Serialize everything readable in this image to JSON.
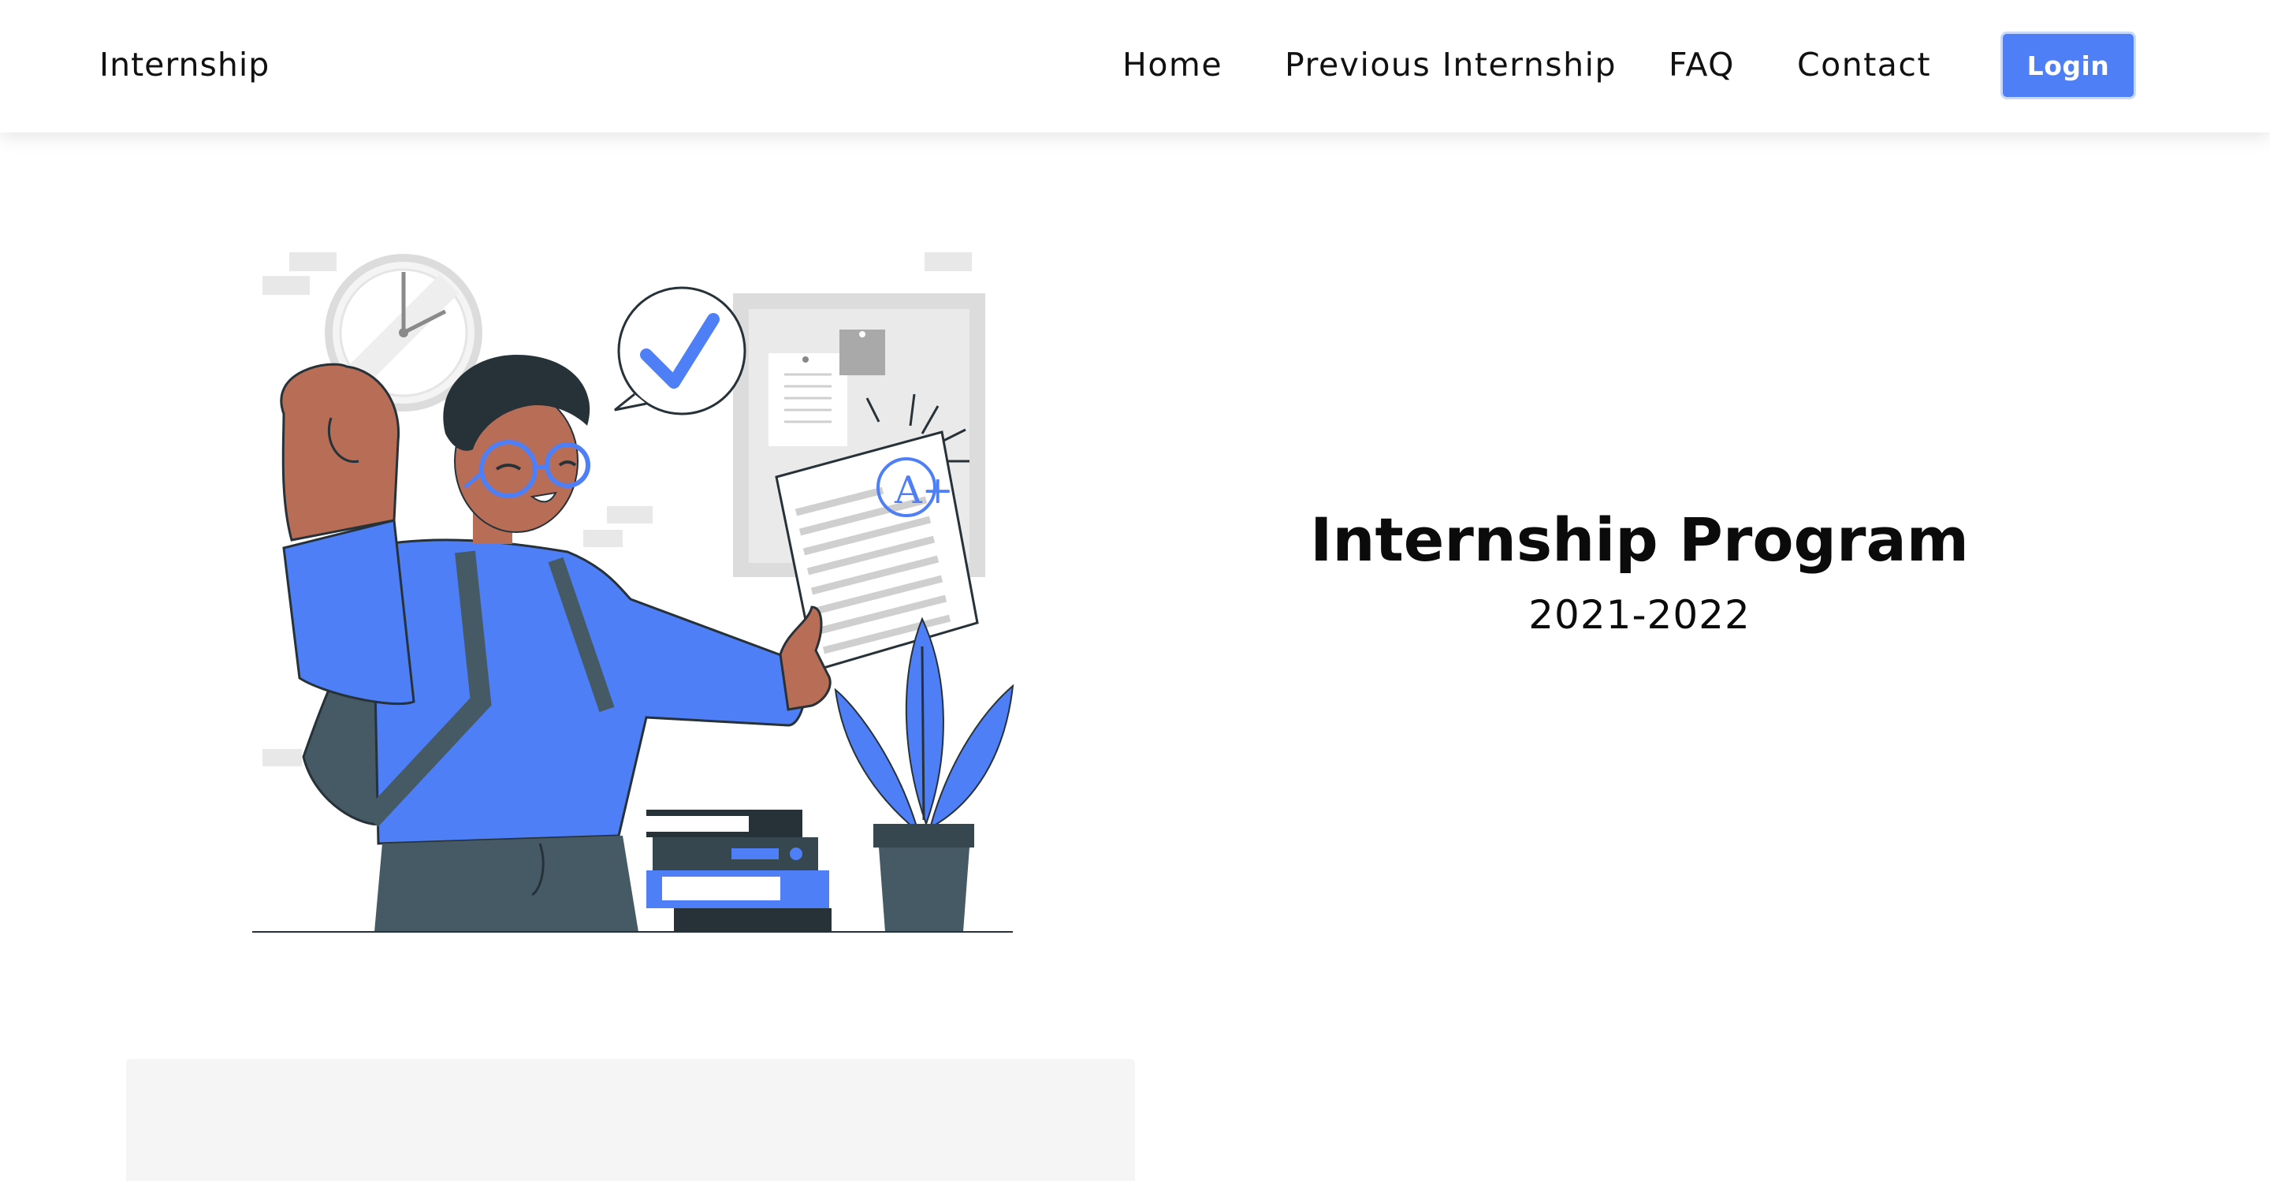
{
  "nav": {
    "brand": "Internship",
    "links": {
      "home": "Home",
      "previous": "Previous Internship",
      "faq": "FAQ",
      "contact": "Contact"
    },
    "login": "Login"
  },
  "hero": {
    "title": "Internship Program",
    "subtitle": "2021-2022",
    "illustration_grade": "A+"
  },
  "colors": {
    "accent": "#4f7ff6",
    "text": "#0b0b0b",
    "card_bg": "#f5f5f5",
    "skin": "#b86d57",
    "dark": "#37474f"
  },
  "icons": {
    "clock": "clock-icon",
    "checkmark": "checkmark-bubble-icon",
    "plant": "plant-icon"
  }
}
